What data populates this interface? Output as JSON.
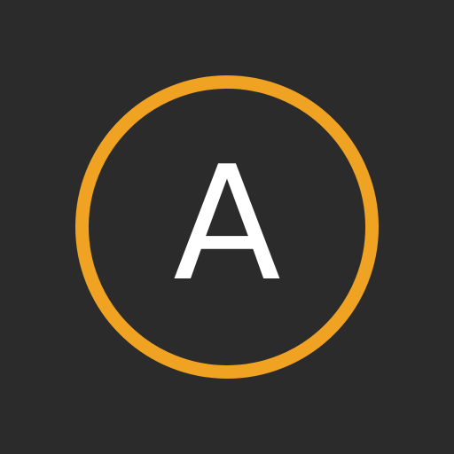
{
  "icon": {
    "letter": "A",
    "name": "letter-a-circle-icon"
  },
  "colors": {
    "background": "#2b2b2b",
    "ring": "#f0a323",
    "letter": "#ffffff"
  }
}
